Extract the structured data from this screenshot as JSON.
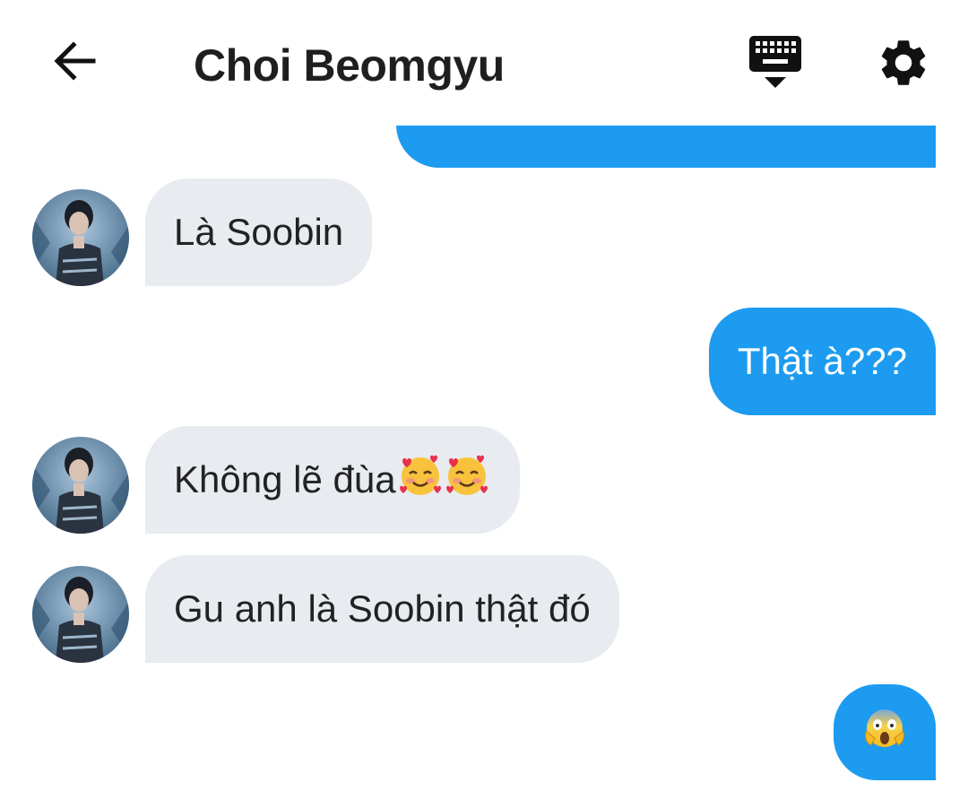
{
  "header": {
    "title": "Choi Beomgyu",
    "back_icon": "arrow-left-icon",
    "keyboard_icon": "keyboard-hide-icon",
    "settings_icon": "gear-icon"
  },
  "colors": {
    "outgoing_bubble": "#1d9bf0",
    "incoming_bubble": "#e8ebef",
    "text_dark": "#222222"
  },
  "messages": [
    {
      "direction": "out",
      "text": ""
    },
    {
      "direction": "in",
      "text": "Là Soobin"
    },
    {
      "direction": "out",
      "text": "Thật à???"
    },
    {
      "direction": "in",
      "text": "Không lẽ đùa",
      "emojis": [
        "smiling-face-with-hearts",
        "smiling-face-with-hearts"
      ]
    },
    {
      "direction": "in",
      "text": "Gu anh là Soobin thật đó"
    },
    {
      "direction": "out",
      "text": "",
      "emojis": [
        "face-screaming-in-fear"
      ]
    }
  ]
}
